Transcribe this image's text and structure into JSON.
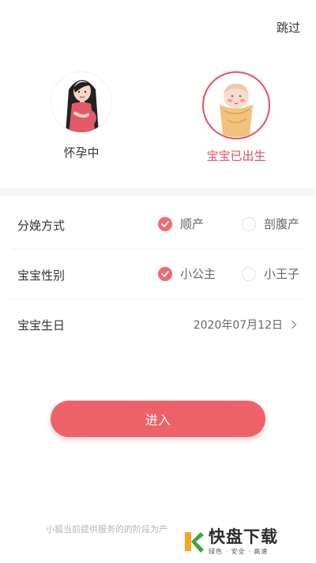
{
  "header": {
    "skip_label": "跳过"
  },
  "stage_options": [
    {
      "label": "怀孕中",
      "selected": false
    },
    {
      "label": "宝宝已出生",
      "selected": true
    }
  ],
  "form": {
    "delivery": {
      "label": "分娩方式",
      "options": [
        "顺产",
        "剖腹产"
      ],
      "selected": "顺产"
    },
    "gender": {
      "label": "宝宝性别",
      "options": [
        "小公主",
        "小王子"
      ],
      "selected": "小公主"
    },
    "birthday": {
      "label": "宝宝生日",
      "value": "2020年07月12日"
    }
  },
  "enter_label": "进入",
  "footer_note": "小狐当前提供服务的的阶段为产",
  "watermark": {
    "logo_text": "快盘下载",
    "tagline": "绿色 · 安全 · 高速"
  },
  "colors": {
    "accent": "#ef6169",
    "selected_text": "#e84f5a",
    "radio_on": "#ef6a72"
  }
}
